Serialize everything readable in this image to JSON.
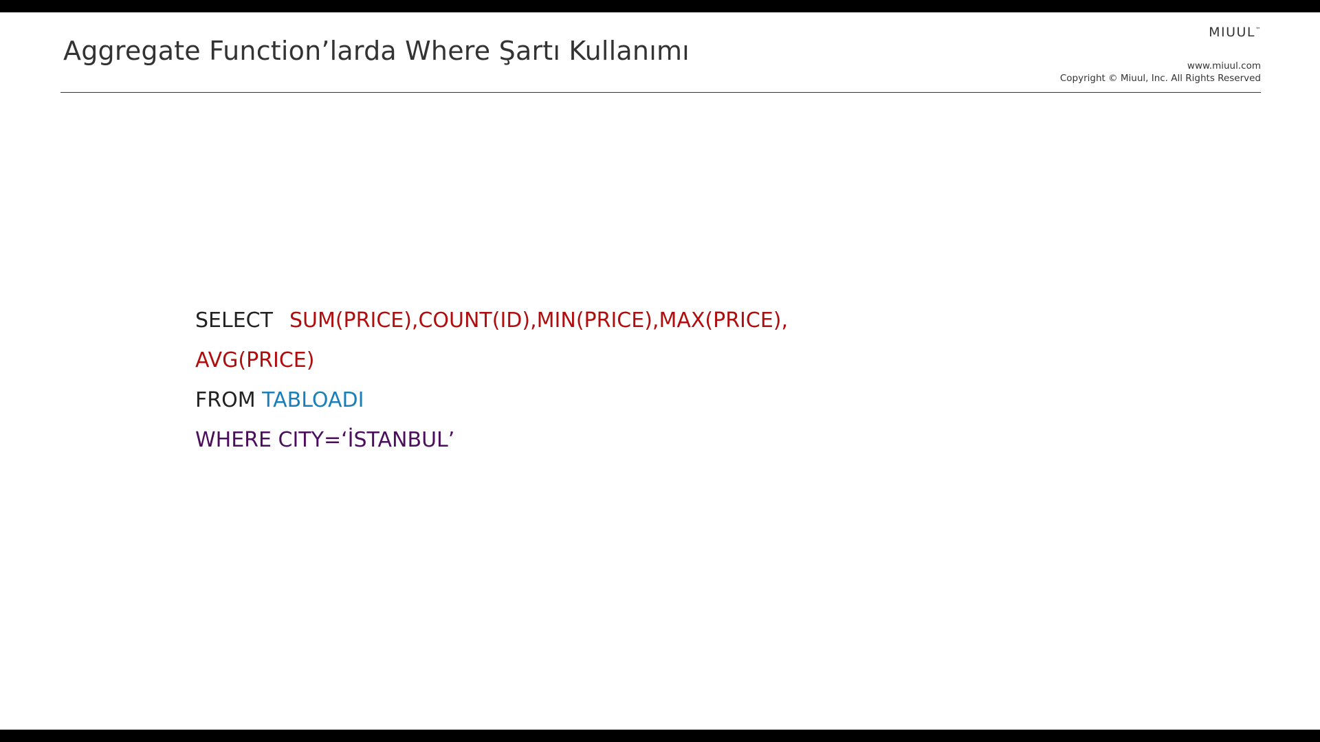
{
  "slide": {
    "title": "Aggregate Function’larda Where Şartı Kullanımı"
  },
  "brand": {
    "name": "MIUUL",
    "trademark": "™",
    "website": "www.miuul.com",
    "copyright": "Copyright © Miuul, Inc. All Rights Reserved"
  },
  "code": {
    "select_keyword": "SELECT",
    "select_functions": "SUM(PRICE),COUNT(ID),MIN(PRICE),MAX(PRICE),",
    "select_functions_cont": "AVG(PRICE)",
    "from_keyword": "FROM ",
    "table_name": "TABLOADI",
    "where_clause": "WHERE CITY=‘İSTANBUL’"
  },
  "colors": {
    "bars": "#000000",
    "text": "#333333",
    "function_red": "#b00e0e",
    "table_blue": "#1a7fb8",
    "where_purple": "#4a0e5c"
  }
}
